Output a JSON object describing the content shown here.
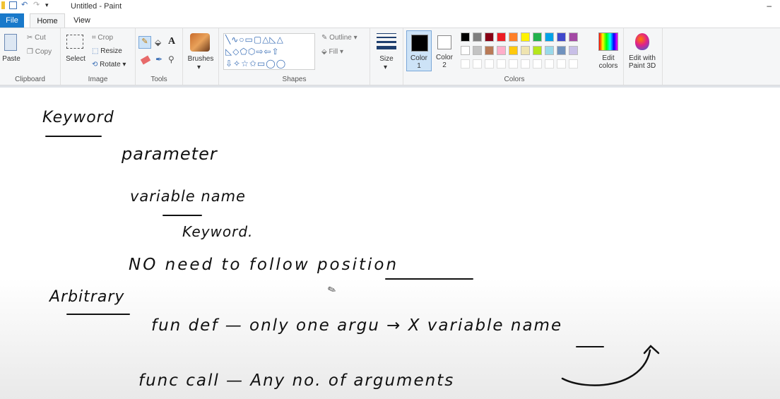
{
  "window": {
    "title": "Untitled - Paint",
    "minimize": "–"
  },
  "tabs": [
    "File",
    "Home",
    "View"
  ],
  "clipboard": {
    "paste": "Paste",
    "cut": "Cut",
    "copy": "Copy",
    "label": "Clipboard"
  },
  "image": {
    "select": "Select",
    "crop": "Crop",
    "resize": "Resize",
    "rotate": "Rotate",
    "label": "Image"
  },
  "tools": {
    "label": "Tools",
    "text_tool": "A"
  },
  "brushes": {
    "label": "Brushes"
  },
  "shapes": {
    "label": "Shapes",
    "outline": "Outline",
    "fill": "Fill"
  },
  "size": {
    "label": "Size"
  },
  "color1": {
    "label": "Color",
    "num": "1"
  },
  "color2": {
    "label": "Color",
    "num": "2"
  },
  "colors": {
    "label": "Colors",
    "palette_row1": [
      "#000000",
      "#7f7f7f",
      "#880015",
      "#ed1c24",
      "#ff7f27",
      "#fff200",
      "#22b14c",
      "#00a2e8",
      "#3f48cc",
      "#a349a4"
    ],
    "palette_row2": [
      "#ffffff",
      "#c3c3c3",
      "#b97a57",
      "#ffaec9",
      "#ffc90e",
      "#efe4b0",
      "#b5e61d",
      "#99d9ea",
      "#7092be",
      "#c8bfe7"
    ]
  },
  "edit_colors": {
    "line1": "Edit",
    "line2": "colors"
  },
  "paint3d": {
    "line1": "Edit with",
    "line2": "Paint 3D"
  },
  "notes": {
    "keyword": "Keyword",
    "parameter": "parameter",
    "variable_name": "variable name",
    "keyword2": "Keyword.",
    "no_need": "NO need to follow position",
    "arbitrary": "Arbitrary",
    "fun_def": "fun def — only one argu → X variable name",
    "func_call": "func call — Any no. of arguments"
  }
}
